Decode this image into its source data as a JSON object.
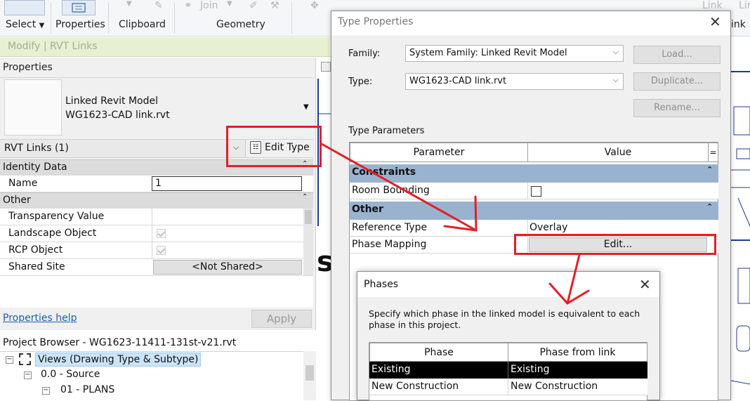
{
  "ribbon": {
    "select_label": "Select",
    "properties_label": "Properties",
    "clipboard_label": "Clipboard",
    "geometry_label": "Geometry",
    "join_label": "Join",
    "link_label": "Link",
    "link_label2": "Lin",
    "right_label": "ink"
  },
  "context_tab": "Modify | RVT Links",
  "properties": {
    "title": "Properties",
    "family_name": "Linked Revit Model",
    "type_name": "WG1623-CAD link.rvt",
    "filter_label": "RVT Links (1)",
    "edit_type_label": "Edit Type",
    "groups": {
      "identity": "Identity Data",
      "other": "Other"
    },
    "rows": {
      "name_label": "Name",
      "name_value": "1",
      "transparency_label": "Transparency Value",
      "landscape_label": "Landscape Object",
      "rcp_label": "RCP Object",
      "shared_site_label": "Shared Site",
      "shared_site_value": "<Not Shared>"
    },
    "help_link": "Properties help",
    "apply_label": "Apply"
  },
  "project_browser": {
    "title": "Project Browser - WG1623-11411-131st-v21.rvt",
    "views_label": "Views (Drawing Type & Subtype)",
    "source_label": "0.0 - Source",
    "plans_label": "01 - PLANS"
  },
  "canvas": {
    "partial_text": "s"
  },
  "type_properties": {
    "title": "Type Properties",
    "family_label": "Family:",
    "family_value": "System Family: Linked Revit Model",
    "type_label": "Type:",
    "type_value": "WG1623-CAD link.rvt",
    "load_label": "Load...",
    "duplicate_label": "Duplicate...",
    "rename_label": "Rename...",
    "type_parameters_label": "Type Parameters",
    "col_parameter": "Parameter",
    "col_value": "Value",
    "col_equals": "=",
    "group_constraints": "Constraints",
    "room_bounding_label": "Room Bounding",
    "group_other": "Other",
    "reference_type_label": "Reference Type",
    "reference_type_value": "Overlay",
    "phase_mapping_label": "Phase Mapping",
    "edit_button_label": "Edit..."
  },
  "phases": {
    "title": "Phases",
    "description": "Specify which phase in the linked model is equivalent to each phase in this project.",
    "col_phase": "Phase",
    "col_phase_from_link": "Phase from link",
    "rows": [
      {
        "phase": "Existing",
        "from_link": "Existing"
      },
      {
        "phase": "New Construction",
        "from_link": "New Construction"
      }
    ]
  },
  "colors": {
    "annotation_red": "#e31f26",
    "group_header_blue": "#99b3cf",
    "context_green": "#e8f0d2",
    "link_blue": "#1a5fb4"
  }
}
